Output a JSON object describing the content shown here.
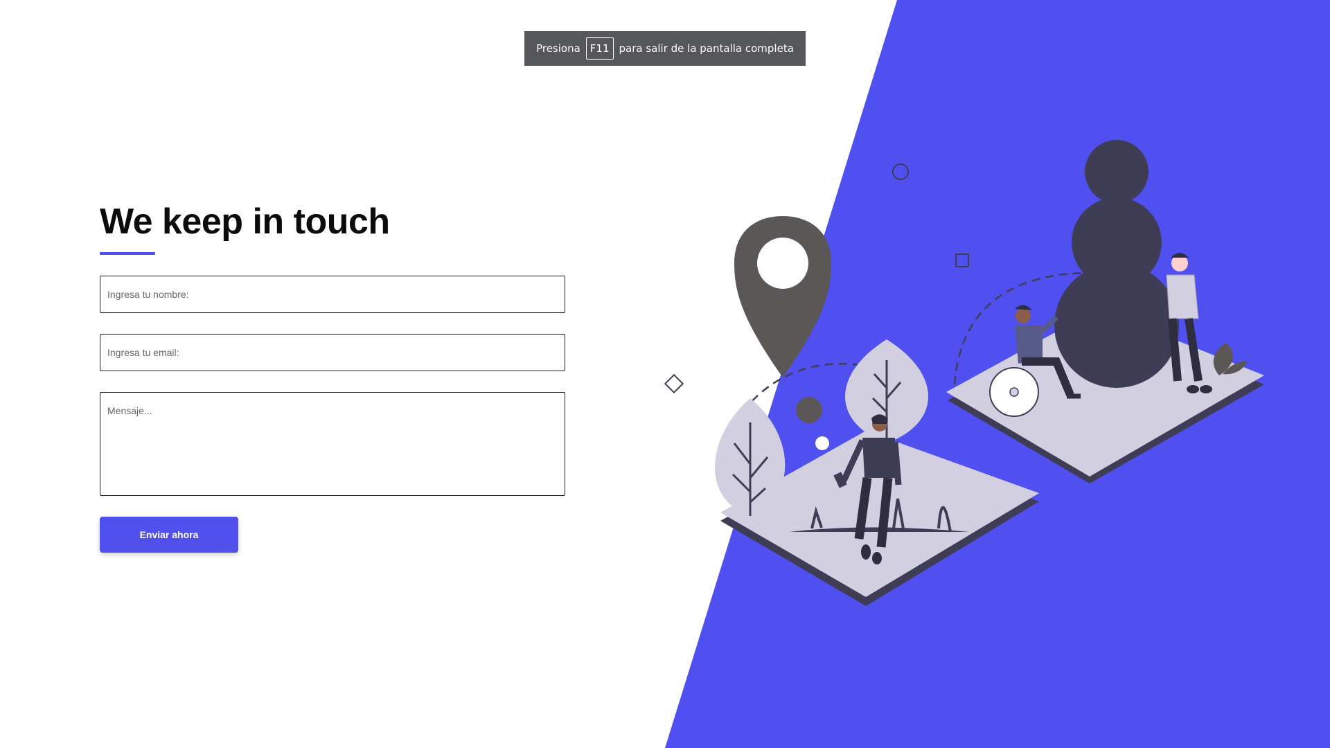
{
  "fullscreen_notice": {
    "prefix": "Presiona",
    "key": "F11",
    "suffix": "para salir de la pantalla completa"
  },
  "contact": {
    "title": "We keep in touch",
    "name_placeholder": "Ingresa tu nombre:",
    "email_placeholder": "Ingresa tu email:",
    "message_placeholder": "Mensaje...",
    "submit_label": "Enviar ahora"
  },
  "colors": {
    "accent": "#5050ec",
    "panel": "#4f50ef",
    "platform": "#d2cfe1",
    "dark_figure": "#3f3d56",
    "pin": "#5c5757"
  },
  "illustration": {
    "icon": "people-location-illustration"
  }
}
